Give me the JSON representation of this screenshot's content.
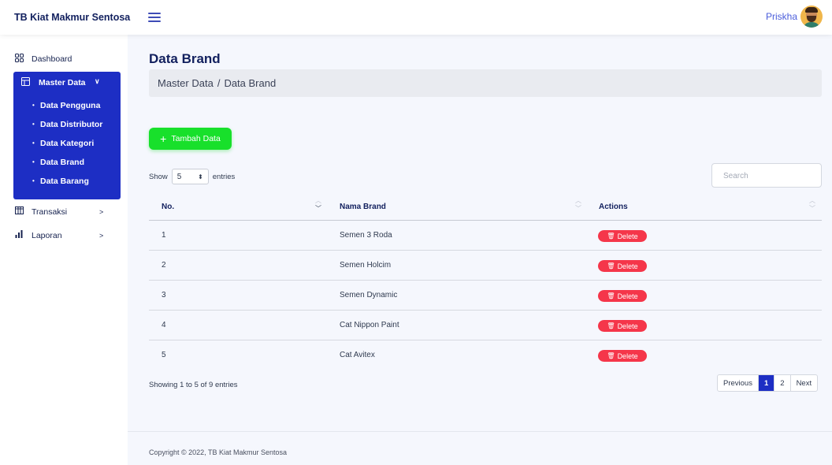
{
  "header": {
    "brand": "TB Kiat Makmur Sentosa",
    "username": "Priskha"
  },
  "sidebar": {
    "dashboard": {
      "label": "Dashboard",
      "icon": "grid-icon"
    },
    "master_data": {
      "label": "Master Data",
      "icon": "table-icon",
      "items": [
        "Data Pengguna",
        "Data Distributor",
        "Data Kategori",
        "Data Brand",
        "Data Barang"
      ]
    },
    "transaksi": {
      "label": "Transaksi",
      "icon": "columns-icon"
    },
    "laporan": {
      "label": "Laporan",
      "icon": "bar-chart-icon"
    }
  },
  "main": {
    "title": "Data Brand",
    "breadcrumb": [
      "Master Data",
      "Data Brand"
    ],
    "add_button": "Tambah Data",
    "show_label": "Show",
    "entries_label": "entries",
    "page_length": "5",
    "search_placeholder": "Search"
  },
  "table": {
    "columns": [
      "No.",
      "Nama Brand",
      "Actions"
    ],
    "rows": [
      {
        "no": "1",
        "name": "Semen 3 Roda",
        "action": "Delete"
      },
      {
        "no": "2",
        "name": "Semen Holcim",
        "action": "Delete"
      },
      {
        "no": "3",
        "name": "Semen Dynamic",
        "action": "Delete"
      },
      {
        "no": "4",
        "name": "Cat Nippon Paint",
        "action": "Delete"
      },
      {
        "no": "5",
        "name": "Cat Avitex",
        "action": "Delete"
      }
    ],
    "info": "Showing 1 to 5 of 9 entries",
    "pagination": {
      "previous": "Previous",
      "pages": [
        "1",
        "2"
      ],
      "current": "1",
      "next": "Next"
    }
  },
  "footer": {
    "copyright": "Copyright © 2022, TB Kiat Makmur Sentosa"
  },
  "colors": {
    "primary": "#1d2ec4",
    "success": "#18e02b",
    "danger": "#f5364a",
    "background": "#f5f7fd"
  }
}
